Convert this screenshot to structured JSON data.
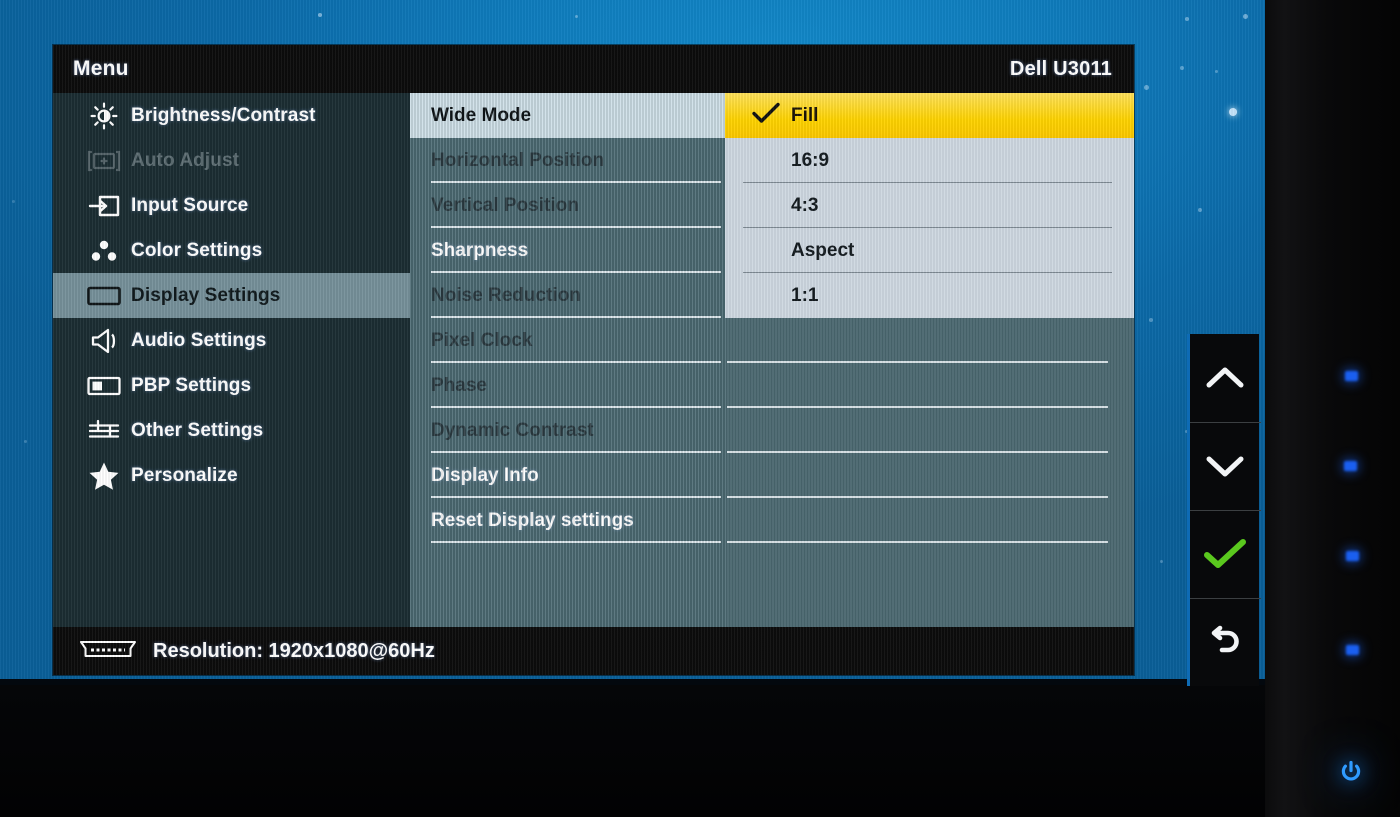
{
  "osd": {
    "title_left": "Menu",
    "title_right": "Dell U3011",
    "status": {
      "icon": "hdmi-connector-icon",
      "text": "Resolution: 1920x1080@60Hz"
    },
    "sidebar": [
      {
        "label": "Brightness/Contrast",
        "icon": "brightness-icon",
        "state": "normal"
      },
      {
        "label": "Auto Adjust",
        "icon": "auto-adjust-icon",
        "state": "disabled"
      },
      {
        "label": "Input Source",
        "icon": "input-source-icon",
        "state": "normal"
      },
      {
        "label": "Color Settings",
        "icon": "color-settings-icon",
        "state": "normal"
      },
      {
        "label": "Display Settings",
        "icon": "display-settings-icon",
        "state": "selected"
      },
      {
        "label": "Audio Settings",
        "icon": "speaker-icon",
        "state": "normal"
      },
      {
        "label": "PBP Settings",
        "icon": "pbp-icon",
        "state": "normal"
      },
      {
        "label": "Other Settings",
        "icon": "sliders-icon",
        "state": "normal"
      },
      {
        "label": "Personalize",
        "icon": "star-icon",
        "state": "normal"
      }
    ],
    "submenu": [
      {
        "label": "Wide Mode",
        "state": "selected"
      },
      {
        "label": "Horizontal Position",
        "state": "disabled"
      },
      {
        "label": "Vertical Position",
        "state": "disabled"
      },
      {
        "label": "Sharpness",
        "state": "normal"
      },
      {
        "label": "Noise Reduction",
        "state": "disabled"
      },
      {
        "label": "Pixel Clock",
        "state": "disabled"
      },
      {
        "label": "Phase",
        "state": "disabled"
      },
      {
        "label": "Dynamic Contrast",
        "state": "disabled"
      },
      {
        "label": "Display Info",
        "state": "normal"
      },
      {
        "label": "Reset Display settings",
        "state": "normal"
      },
      {
        "label": "",
        "state": "blank"
      },
      {
        "label": "",
        "state": "blank"
      }
    ],
    "dropdown": {
      "for": "Wide Mode",
      "options": [
        {
          "label": "Fill",
          "checked": true
        },
        {
          "label": "16:9",
          "checked": false
        },
        {
          "label": "4:3",
          "checked": false
        },
        {
          "label": "Aspect",
          "checked": false
        },
        {
          "label": "1:1",
          "checked": false
        }
      ]
    }
  },
  "hardware_buttons": [
    {
      "name": "up-chevron-button",
      "icon": "chevron-up-icon"
    },
    {
      "name": "down-chevron-button",
      "icon": "chevron-down-icon"
    },
    {
      "name": "confirm-button",
      "icon": "checkmark-icon"
    },
    {
      "name": "back-button",
      "icon": "back-arrow-icon"
    }
  ],
  "power_button": {
    "icon": "power-icon"
  },
  "colors": {
    "osd_background": "#1b2d33",
    "submenu_background": "#4d6b74",
    "selected_row": "#cfe0e8",
    "sidebar_selected": "#76909a",
    "highlight_yellow": "#ffd400",
    "dropdown_background": "#cfd8e1",
    "titlebar": "#0c0c0c",
    "wallpaper_blue": "#0f7cbd",
    "confirm_green": "#5ac81e",
    "power_led_blue": "#1b7fe8"
  }
}
